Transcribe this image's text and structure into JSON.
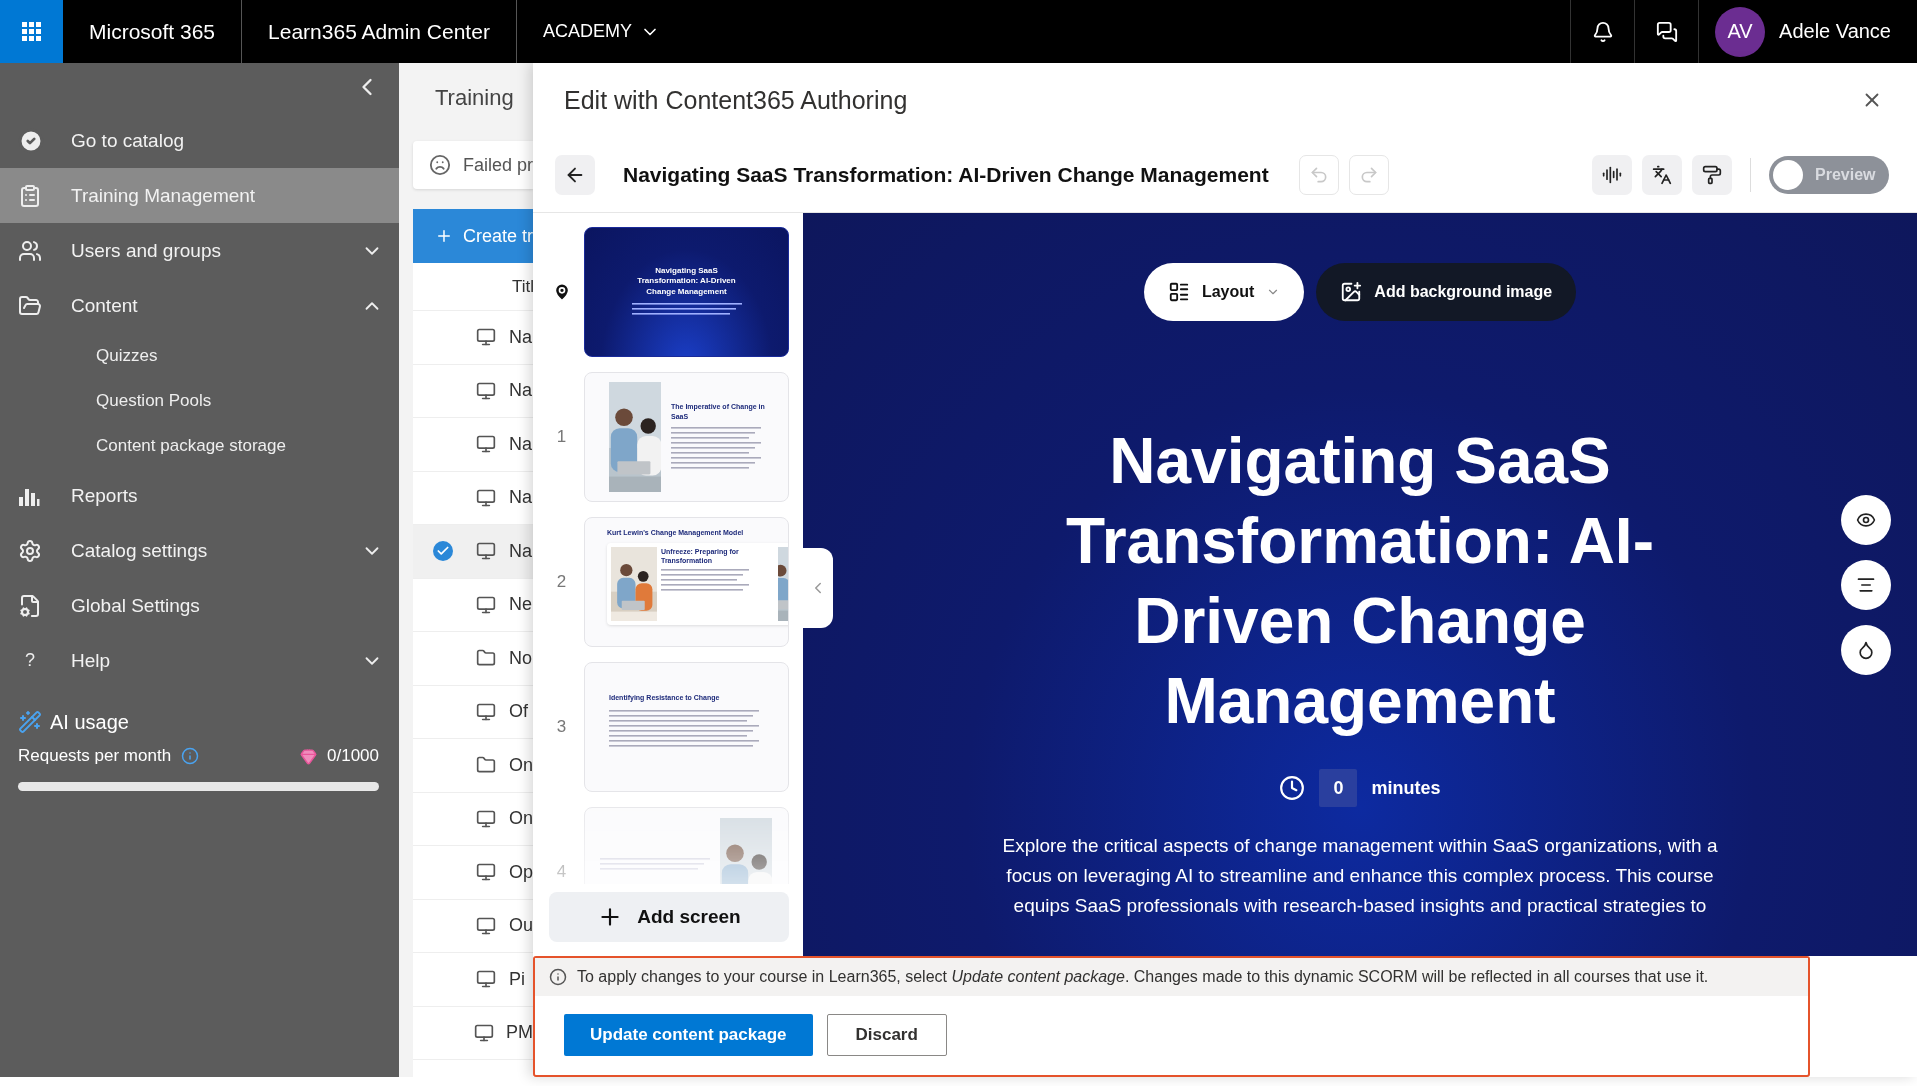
{
  "top_bar": {
    "app_name": "Microsoft 365",
    "admin_center": "Learn365 Admin Center",
    "tenant": "ACADEMY",
    "user": {
      "initials": "AV",
      "name": "Adele Vance"
    }
  },
  "sidebar": {
    "items": [
      {
        "label": "Go to catalog",
        "selected": false
      },
      {
        "label": "Training Management",
        "selected": true
      },
      {
        "label": "Users and groups",
        "selected": false,
        "expanded": false
      },
      {
        "label": "Content",
        "selected": false,
        "expanded": true,
        "children": [
          {
            "label": "Quizzes"
          },
          {
            "label": "Question Pools"
          },
          {
            "label": "Content package storage"
          }
        ]
      },
      {
        "label": "Reports",
        "selected": false
      },
      {
        "label": "Catalog settings",
        "selected": false,
        "expanded": false
      },
      {
        "label": "Global Settings",
        "selected": false
      },
      {
        "label": "Help",
        "glyph": "?",
        "selected": false,
        "expanded": false
      }
    ],
    "ai_usage": {
      "title": "AI usage",
      "label": "Requests per month",
      "count": "0/1000",
      "level": 0
    }
  },
  "list_panel": {
    "title": "Training",
    "filter": "Failed pr",
    "create_button": "Create tr",
    "column": "Titl",
    "rows": [
      {
        "kind": "screen",
        "label": "Na",
        "selected": false
      },
      {
        "kind": "screen",
        "label": "Na",
        "selected": false
      },
      {
        "kind": "screen",
        "label": "Na",
        "selected": false
      },
      {
        "kind": "screen",
        "label": "Na",
        "selected": false
      },
      {
        "kind": "screen",
        "label": "Na",
        "selected": true
      },
      {
        "kind": "screen",
        "label": "Ne",
        "selected": false
      },
      {
        "kind": "folder",
        "label": "No",
        "selected": false
      },
      {
        "kind": "screen",
        "label": "Of",
        "selected": false
      },
      {
        "kind": "folder",
        "label": "On",
        "selected": false
      },
      {
        "kind": "screen",
        "label": "On",
        "selected": false
      },
      {
        "kind": "screen",
        "label": "Op",
        "selected": false
      },
      {
        "kind": "screen",
        "label": "Ou",
        "selected": false
      },
      {
        "kind": "screen",
        "label": "Pi",
        "selected": false
      },
      {
        "kind": "screen",
        "label": "PM",
        "selected": false
      }
    ]
  },
  "editor": {
    "title": "Edit with Content365 Authoring",
    "course_title": "Navigating SaaS Transformation: AI-Driven Change Management",
    "undo_disabled": true,
    "redo_disabled": true,
    "preview_label": "Preview",
    "preview_on": false,
    "slides": [
      {
        "kind": "cover",
        "heading": "Navigating SaaS Transformation: AI-Driven Change Management"
      },
      {
        "kind": "image-left",
        "number": "1",
        "heading": "The Imperative of Change in SaaS"
      },
      {
        "kind": "image-card",
        "number": "2",
        "heading": "Kurt Lewin's Change Management Model",
        "subheading": "Unfreeze: Preparing for Transformation"
      },
      {
        "kind": "bullets",
        "number": "3",
        "heading": "Identifying Resistance to Change"
      },
      {
        "kind": "image-right",
        "number": "4"
      }
    ],
    "add_screen": "Add screen",
    "canvas": {
      "layout_button": "Layout",
      "background_button": "Add background image",
      "heading": "Navigating SaaS Transformation: AI-Driven Change Management",
      "duration": "0",
      "duration_unit": "minutes",
      "description": "Explore the critical aspects of change management within SaaS organizations, with a focus on leveraging AI to streamline and enhance this complex process. This course equips SaaS professionals with research-based insights and practical strategies to"
    },
    "notice": {
      "text": "To apply changes to your course in Learn365, select *Update content package*. Changes made to this dynamic SCORM will be reflected in all courses that use it.",
      "primary_button": "Update content package",
      "secondary_button": "Discard"
    }
  }
}
